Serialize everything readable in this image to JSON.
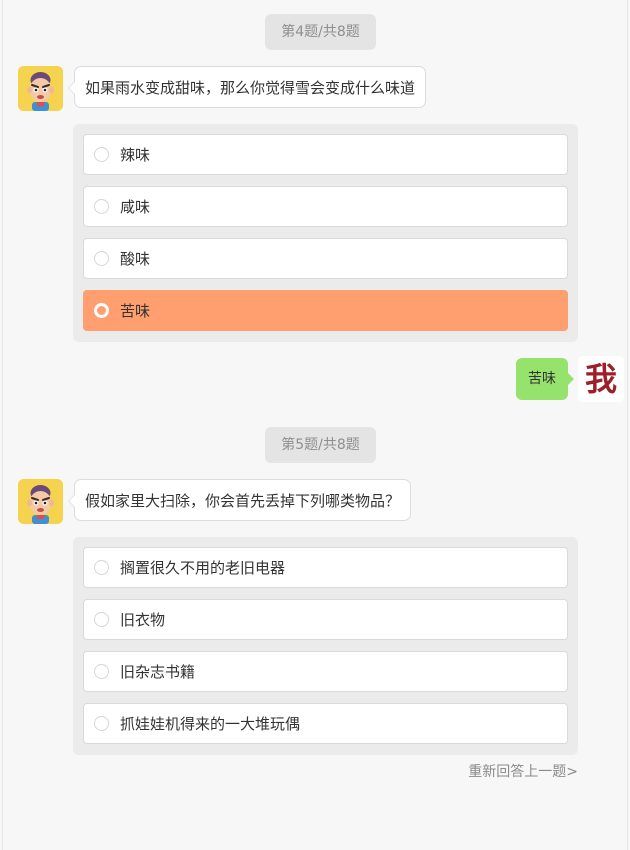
{
  "colors": {
    "page_bg": "#f7f7f7",
    "selected_option": "#ff9e6e",
    "user_bubble": "#95e36c",
    "user_avatar_text": "#9c1f2a",
    "progress_pill_bg": "#e4e4e4"
  },
  "questions": [
    {
      "progress": "第4题/共8题",
      "text": "如果雨水变成甜味，那么你觉得雪会变成什么味道",
      "options": [
        "辣味",
        "咸味",
        "酸味",
        "苦味"
      ],
      "selected_option": "苦味",
      "user_answer": "苦味"
    },
    {
      "progress": "第5题/共8题",
      "text": "假如家里大扫除，你会首先丢掉下列哪类物品？",
      "options": [
        "搁置很久不用的老旧电器",
        "旧衣物",
        "旧杂志书籍",
        "抓娃娃机得来的一大堆玩偶"
      ],
      "selected_option": null
    }
  ],
  "user": {
    "avatar_text": "我",
    "avatar_icon": "me-badge-icon"
  },
  "bot": {
    "avatar_icon": "cartoon-boy-avatar-icon"
  },
  "footer": {
    "redo_label": "重新回答上一题>"
  }
}
